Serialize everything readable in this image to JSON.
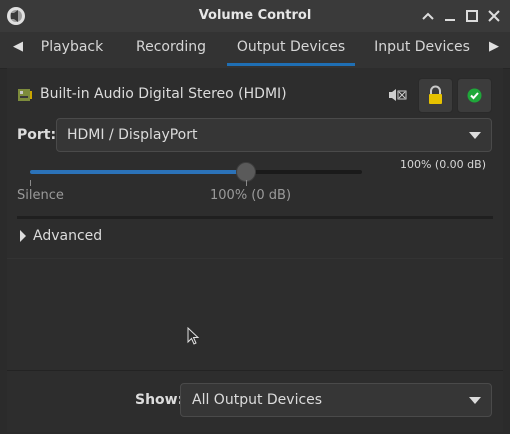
{
  "window": {
    "title": "Volume Control",
    "controls": [
      "minimize",
      "maximize",
      "close"
    ]
  },
  "tabs": {
    "items": [
      {
        "label": "Playback",
        "active": false
      },
      {
        "label": "Recording",
        "active": false
      },
      {
        "label": "Output Devices",
        "active": true
      },
      {
        "label": "Input Devices",
        "active": false
      }
    ]
  },
  "device": {
    "name": "Built-in Audio Digital Stereo (HDMI)",
    "port_label": "Port:",
    "port_value": "HDMI / DisplayPort",
    "volume_readout": "100% (0.00 dB)",
    "volume_fraction": 0.65,
    "silence_label": "Silence",
    "mark_label": "100% (0 dB)"
  },
  "advanced": {
    "label": "Advanced"
  },
  "footer": {
    "show_label": "Show:",
    "show_value": "All Output Devices"
  },
  "icons": {
    "app": "volume-icon",
    "mute": "speaker-mute-icon",
    "lock": "lock-icon",
    "default": "checkmark-icon"
  },
  "colors": {
    "accent": "#1f6fb4",
    "lock": "#e6c200",
    "default_check": "#1fa83a"
  }
}
